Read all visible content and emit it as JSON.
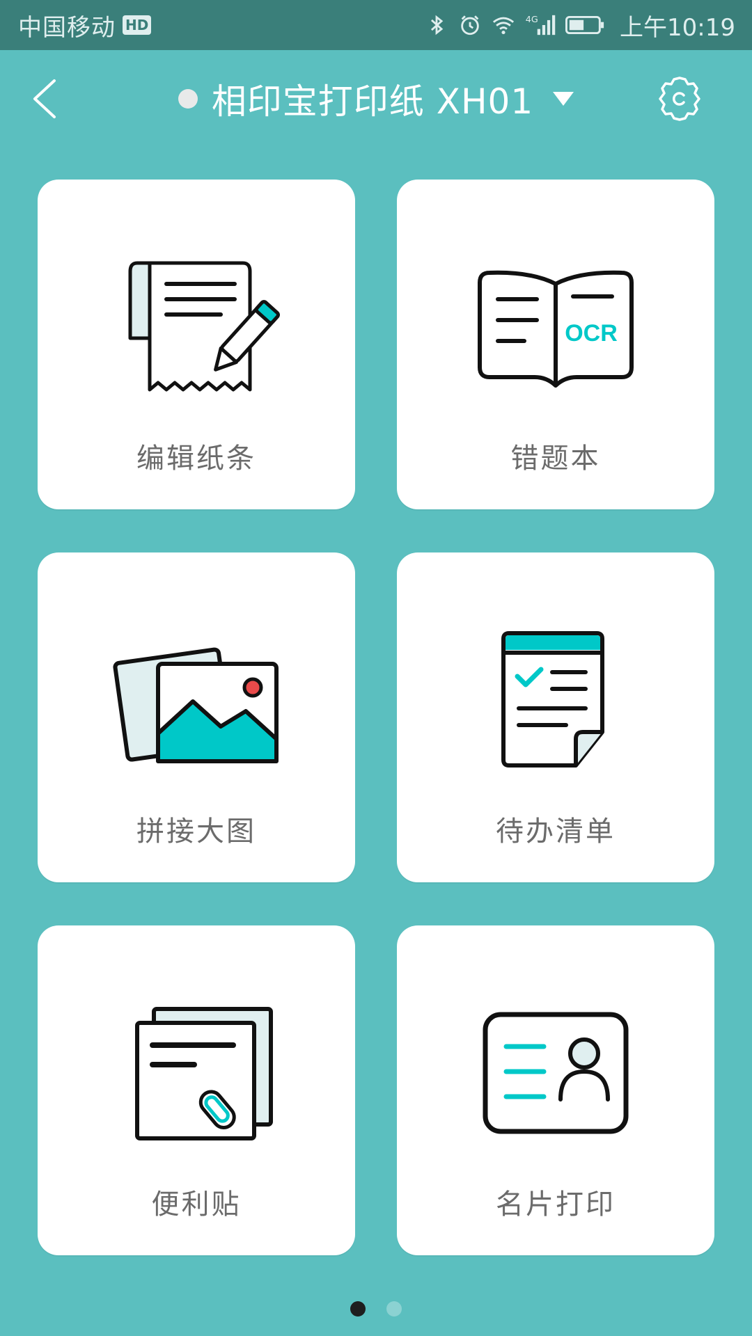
{
  "status_bar": {
    "carrier": "中国移动",
    "hd_badge": "HD",
    "network_label": "4G",
    "time": "上午10:19",
    "icons": [
      "bluetooth-icon",
      "alarm-icon",
      "wifi-icon",
      "signal-icon",
      "battery-icon"
    ]
  },
  "header": {
    "device_name": "相印宝打印纸 XH01",
    "back_icon": "chevron-left-icon",
    "settings_icon": "gear-icon",
    "dropdown_icon": "caret-down-icon"
  },
  "features": [
    {
      "label": "编辑纸条",
      "icon": "receipt-pencil-icon"
    },
    {
      "label": "错题本",
      "icon": "book-ocr-icon"
    },
    {
      "label": "拼接大图",
      "icon": "photos-icon"
    },
    {
      "label": "待办清单",
      "icon": "checklist-icon"
    },
    {
      "label": "便利贴",
      "icon": "sticky-note-icon"
    },
    {
      "label": "名片打印",
      "icon": "business-card-icon"
    }
  ],
  "book_icon_text": "OCR",
  "pager": {
    "total": 2,
    "active": 1
  },
  "colors": {
    "background": "#5bbfbf",
    "status_bar": "#3a7f7a",
    "accent": "#00c8c8",
    "card": "#ffffff",
    "label_text": "#6b6b6b"
  }
}
